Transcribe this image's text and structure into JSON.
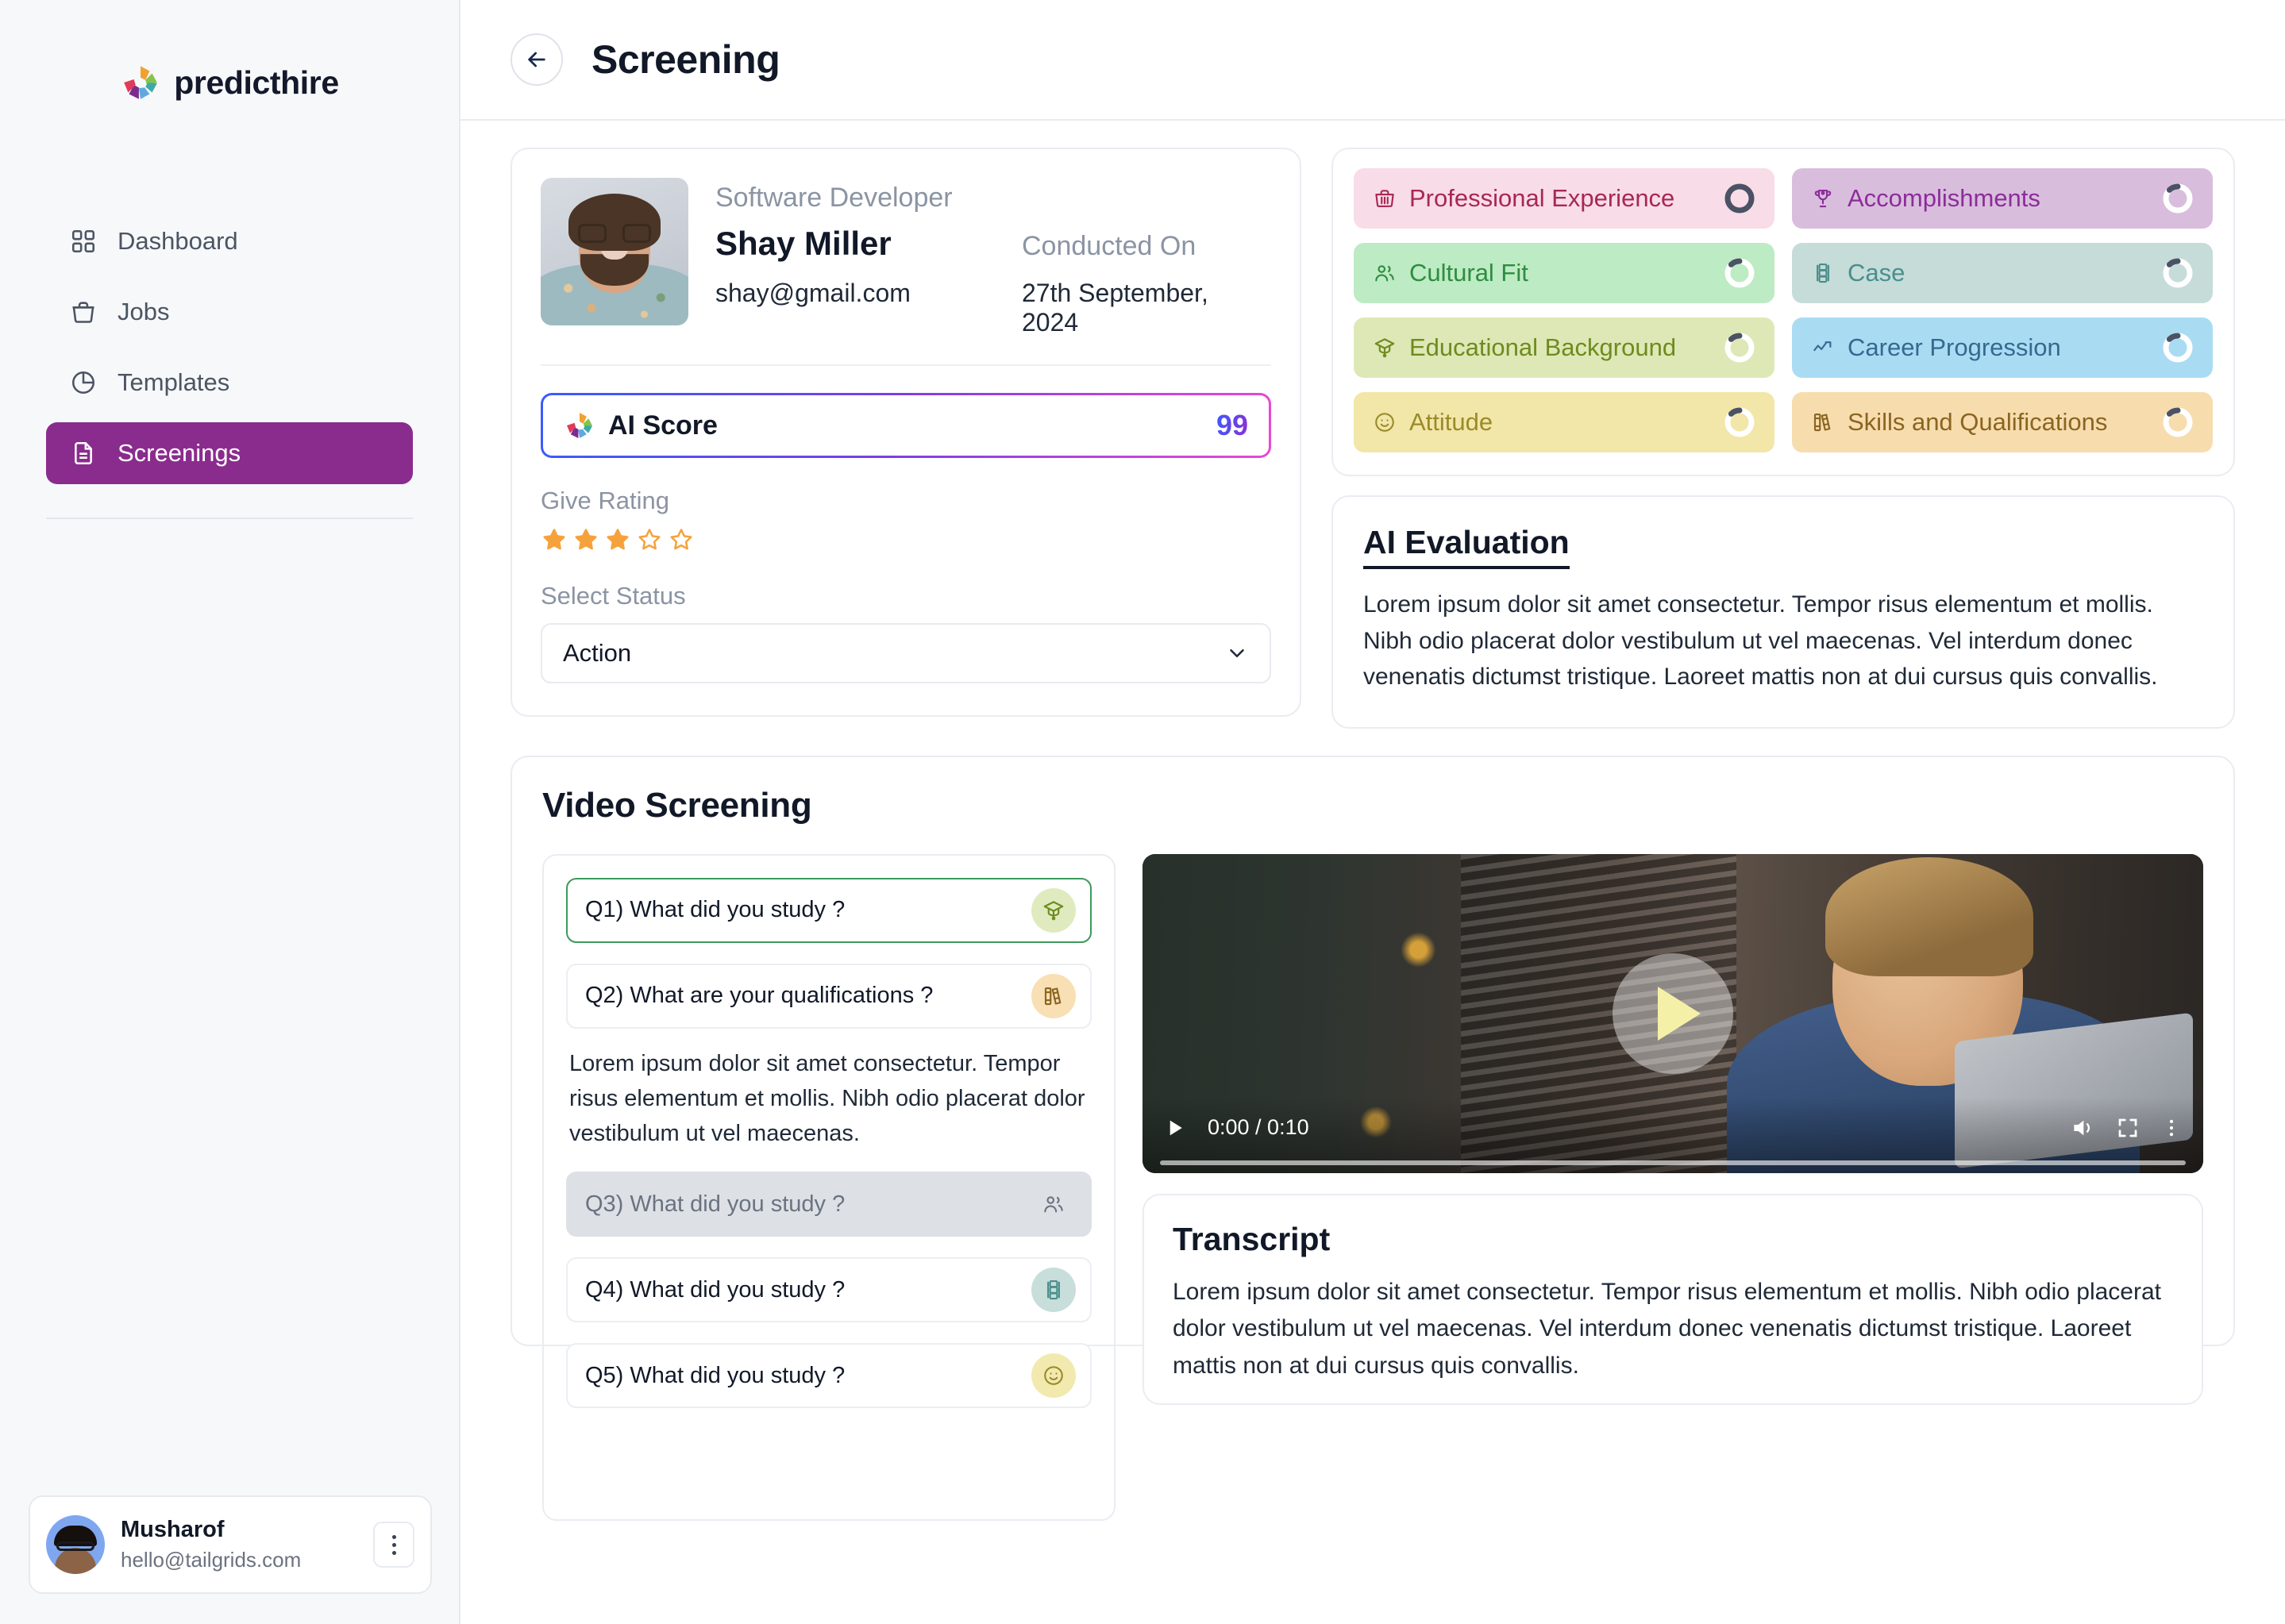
{
  "brand": {
    "name": "predicthire"
  },
  "sidebar": {
    "items": [
      {
        "label": "Dashboard",
        "icon": "grid-icon",
        "active": false
      },
      {
        "label": "Jobs",
        "icon": "briefcase-icon",
        "active": false
      },
      {
        "label": "Templates",
        "icon": "pie-chart-icon",
        "active": false
      },
      {
        "label": "Screenings",
        "icon": "document-icon",
        "active": true
      }
    ],
    "user": {
      "name": "Musharof",
      "email": "hello@tailgrids.com",
      "more_icon": "vertical-dots-icon"
    }
  },
  "header": {
    "title": "Screening",
    "back_icon": "arrow-left-icon"
  },
  "profile": {
    "job_title": "Software Developer",
    "name": "Shay Miller",
    "email": "shay@gmail.com",
    "conducted_on_label": "Conducted On",
    "conducted_on_value": "27th September, 2024",
    "ai_score_label": "AI Score",
    "ai_score_value": "99",
    "rating_label": "Give Rating",
    "rating_value": 3,
    "rating_max": 5,
    "status_label": "Select Status",
    "status_value": "Action"
  },
  "categories": [
    {
      "label": "Professional Experience",
      "icon": "briefcase-icon",
      "bg": "#F8DCE7",
      "fg": "#A82753",
      "progress": "full"
    },
    {
      "label": "Accomplishments",
      "icon": "trophy-icon",
      "bg": "#D9BDDD",
      "fg": "#8B2D99",
      "progress": "partial"
    },
    {
      "label": "Cultural Fit",
      "icon": "users-icon",
      "bg": "#BDEBC3",
      "fg": "#2F8C42",
      "progress": "partial"
    },
    {
      "label": "Case",
      "icon": "stack-icon",
      "bg": "#C5DCD9",
      "fg": "#4A8E8B",
      "progress": "partial"
    },
    {
      "label": "Educational Background",
      "icon": "cap-icon",
      "bg": "#DEE8B6",
      "fg": "#6E8B1E",
      "progress": "partial"
    },
    {
      "label": "Career Progression",
      "icon": "trend-icon",
      "bg": "#A9DCF3",
      "fg": "#36698E",
      "progress": "partial"
    },
    {
      "label": "Attitude",
      "icon": "smiley-icon",
      "bg": "#F2E6A8",
      "fg": "#9A8B2A",
      "progress": "partial"
    },
    {
      "label": "Skills and Qualifications",
      "icon": "books-icon",
      "bg": "#F7DCAE",
      "fg": "#8A6520",
      "progress": "partial"
    }
  ],
  "evaluation": {
    "title": "AI Evaluation",
    "body": "Lorem ipsum dolor sit amet consectetur. Tempor risus elementum et mollis. Nibh odio placerat dolor vestibulum ut vel maecenas. Vel interdum donec venenatis dictumst tristique. Laoreet mattis non at dui cursus quis convallis."
  },
  "video_screening": {
    "title": "Video Screening",
    "questions": [
      {
        "text": "Q1) What did you study ?",
        "icon": "cap-icon",
        "icon_bg": "#DFEBBF",
        "icon_fg": "#6E8B1E",
        "state": "active"
      },
      {
        "text": "Q2) What are your qualifications ?",
        "icon": "books-icon",
        "icon_bg": "#F8DFB4",
        "icon_fg": "#8A6520",
        "state": "expanded"
      },
      {
        "text": "Q3) What did you study ?",
        "icon": "users-icon",
        "icon_bg": "transparent",
        "icon_fg": "#6B7280",
        "state": "muted"
      },
      {
        "text": "Q4) What did you study ?",
        "icon": "stack-icon",
        "icon_bg": "#C7DEDB",
        "icon_fg": "#4A8E8B",
        "state": "default"
      },
      {
        "text": "Q5) What did you study ?",
        "icon": "smiley-icon",
        "icon_bg": "#F2E9AF",
        "icon_fg": "#9A8B2A",
        "state": "default"
      }
    ],
    "answer": "Lorem ipsum dolor sit amet consectetur. Tempor risus elementum et mollis. Nibh odio placerat dolor vestibulum ut vel maecenas.",
    "player": {
      "time": "0:00 / 0:10",
      "play_icon": "play-icon",
      "volume_icon": "volume-icon",
      "fullscreen_icon": "fullscreen-icon",
      "more_icon": "vertical-dots-icon",
      "overlay_play_icon": "play-triangle-icon"
    }
  },
  "transcript": {
    "title": "Transcript",
    "body": "Lorem ipsum dolor sit amet consectetur. Tempor risus elementum et mollis. Nibh odio placerat dolor vestibulum ut vel maecenas. Vel interdum donec venenatis dictumst tristique. Laoreet mattis non at dui cursus quis convallis."
  },
  "colors": {
    "accent": "#8A2C8D",
    "star_filled": "#F5A23C",
    "ai_gradient_start": "#3B5BFF",
    "ai_gradient_end": "#E948D6"
  }
}
